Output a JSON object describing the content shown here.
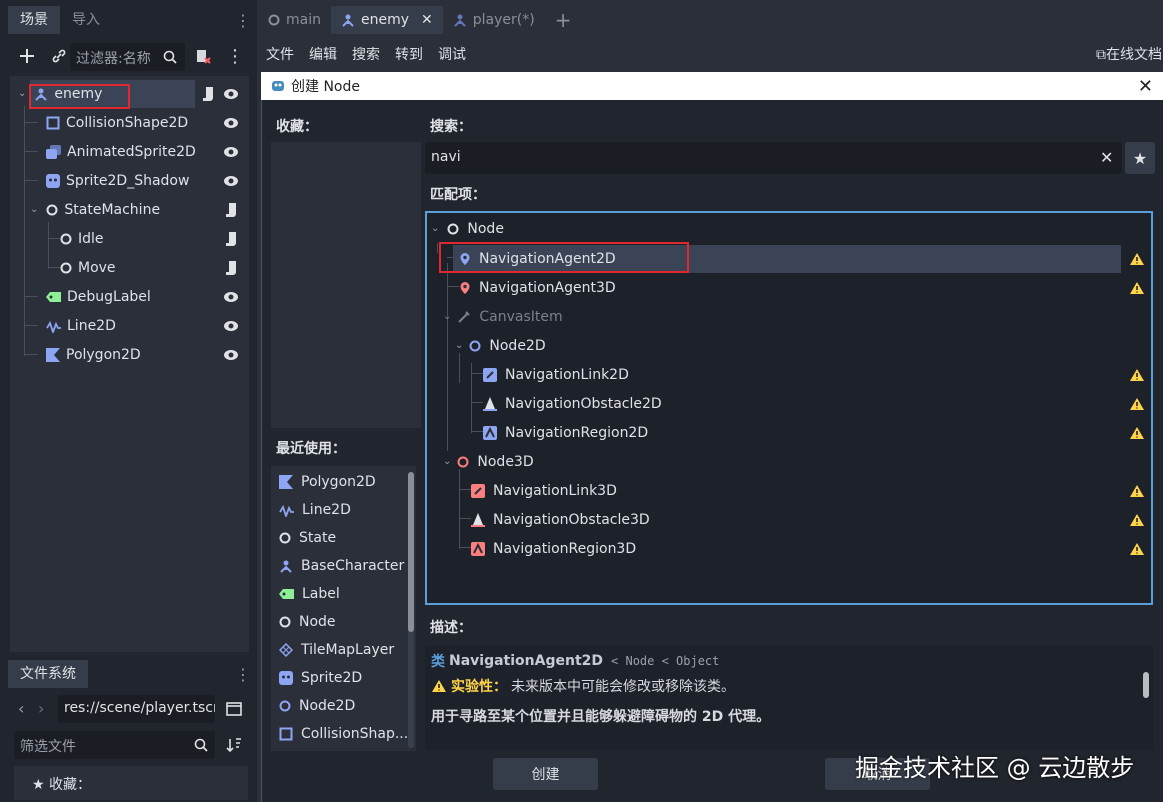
{
  "left_dock": {
    "tabs": [
      "场景",
      "导入"
    ],
    "filter_placeholder": "过滤器:名称",
    "tree": [
      {
        "label": "enemy",
        "icon": "character-icon",
        "color": "#8da5f3",
        "script": true,
        "eye": true
      },
      {
        "label": "CollisionShape2D",
        "icon": "collision-shape-icon",
        "color": "#8da5f3",
        "eye": true
      },
      {
        "label": "AnimatedSprite2D",
        "icon": "animated-sprite-icon",
        "color": "#8da5f3",
        "eye": true
      },
      {
        "label": "Sprite2D_Shadow",
        "icon": "sprite-icon",
        "color": "#8da5f3",
        "eye": true
      },
      {
        "label": "StateMachine",
        "icon": "node-circle-icon",
        "color": "#ffffff",
        "script": true
      },
      {
        "label": "Idle",
        "icon": "node-circle-icon",
        "color": "#ffffff",
        "script": true
      },
      {
        "label": "Move",
        "icon": "node-circle-icon",
        "color": "#ffffff",
        "script": true
      },
      {
        "label": "DebugLabel",
        "icon": "label-icon",
        "color": "#8eef97",
        "eye": true
      },
      {
        "label": "Line2D",
        "icon": "line-icon",
        "color": "#8da5f3",
        "eye": true
      },
      {
        "label": "Polygon2D",
        "icon": "polygon-icon",
        "color": "#8da5f3",
        "eye": true
      }
    ],
    "fs_tab": "文件系统",
    "fs_path": "res://scene/player.tscn",
    "fs_filter_placeholder": "筛选文件",
    "fs_favorites": "收藏："
  },
  "editor_tabs": [
    {
      "label": "main",
      "icon": "circle-icon",
      "active": false
    },
    {
      "label": "enemy",
      "icon": "character-icon",
      "active": true,
      "close": "✕"
    },
    {
      "label": "player(*)",
      "icon": "character-icon",
      "active": false
    }
  ],
  "add_tab": "+",
  "menu": [
    "文件",
    "编辑",
    "搜索",
    "转到",
    "调试"
  ],
  "doc_link": "在线文档",
  "dialog": {
    "title": "创建 Node",
    "favorites_label": "收藏：",
    "recent_label": "最近使用：",
    "recent": [
      {
        "label": "Polygon2D",
        "icon": "polygon-icon"
      },
      {
        "label": "Line2D",
        "icon": "line-icon"
      },
      {
        "label": "State",
        "icon": "node-circle-icon"
      },
      {
        "label": "BaseCharacter",
        "icon": "character-icon"
      },
      {
        "label": "Label",
        "icon": "label-icon"
      },
      {
        "label": "Node",
        "icon": "node-circle-icon"
      },
      {
        "label": "TileMapLayer",
        "icon": "tilemap-icon"
      },
      {
        "label": "Sprite2D",
        "icon": "sprite-icon"
      },
      {
        "label": "Node2D",
        "icon": "node2d-circle-icon"
      },
      {
        "label": "CollisionShap...",
        "icon": "collision-shape-icon"
      }
    ],
    "search_label": "搜索：",
    "search_value": "navi",
    "matches_label": "匹配项：",
    "matches": [
      {
        "label": "Node",
        "icon": "node-circle-icon",
        "level": 0,
        "expand": true
      },
      {
        "label": "NavigationAgent2D",
        "icon": "nav-agent-2d-icon",
        "level": 1,
        "selected": true,
        "warn": true
      },
      {
        "label": "NavigationAgent3D",
        "icon": "nav-agent-3d-icon",
        "level": 1,
        "warn": true
      },
      {
        "label": "CanvasItem",
        "icon": "canvas-item-icon",
        "level": 1,
        "expand": true,
        "dim": true
      },
      {
        "label": "Node2D",
        "icon": "node2d-circle-icon",
        "level": 2,
        "expand": true
      },
      {
        "label": "NavigationLink2D",
        "icon": "nav-link-2d-icon",
        "level": 3,
        "warn": true
      },
      {
        "label": "NavigationObstacle2D",
        "icon": "nav-obstacle-2d-icon",
        "level": 3,
        "warn": true
      },
      {
        "label": "NavigationRegion2D",
        "icon": "nav-region-2d-icon",
        "level": 3,
        "warn": true
      },
      {
        "label": "Node3D",
        "icon": "node3d-circle-icon",
        "level": 1,
        "expand": true
      },
      {
        "label": "NavigationLink3D",
        "icon": "nav-link-3d-icon",
        "level": 2,
        "warn": true
      },
      {
        "label": "NavigationObstacle3D",
        "icon": "nav-obstacle-3d-icon",
        "level": 2,
        "warn": true
      },
      {
        "label": "NavigationRegion3D",
        "icon": "nav-region-3d-icon",
        "level": 2,
        "warn": true
      }
    ],
    "desc_label": "描述：",
    "desc_class_prefix": "类",
    "desc_class": "NavigationAgent2D",
    "desc_inherits": "< Node < Object",
    "desc_experimental_label": "实验性：",
    "desc_experimental_text": "未来版本中可能会修改或移除该类。",
    "desc_text": "用于寻路至某个位置并且能够躲避障碍物的 2D 代理。",
    "create_button": "创建",
    "cancel_button": "取消"
  },
  "watermark": "掘金技术社区 @ 云边散步",
  "colors": {
    "accent": "#5a9fd9",
    "highlight": "#e0282e",
    "warning": "#ffd34a",
    "node2d": "#8da5f3",
    "node3d": "#fc7f7f",
    "control": "#8eef97"
  }
}
